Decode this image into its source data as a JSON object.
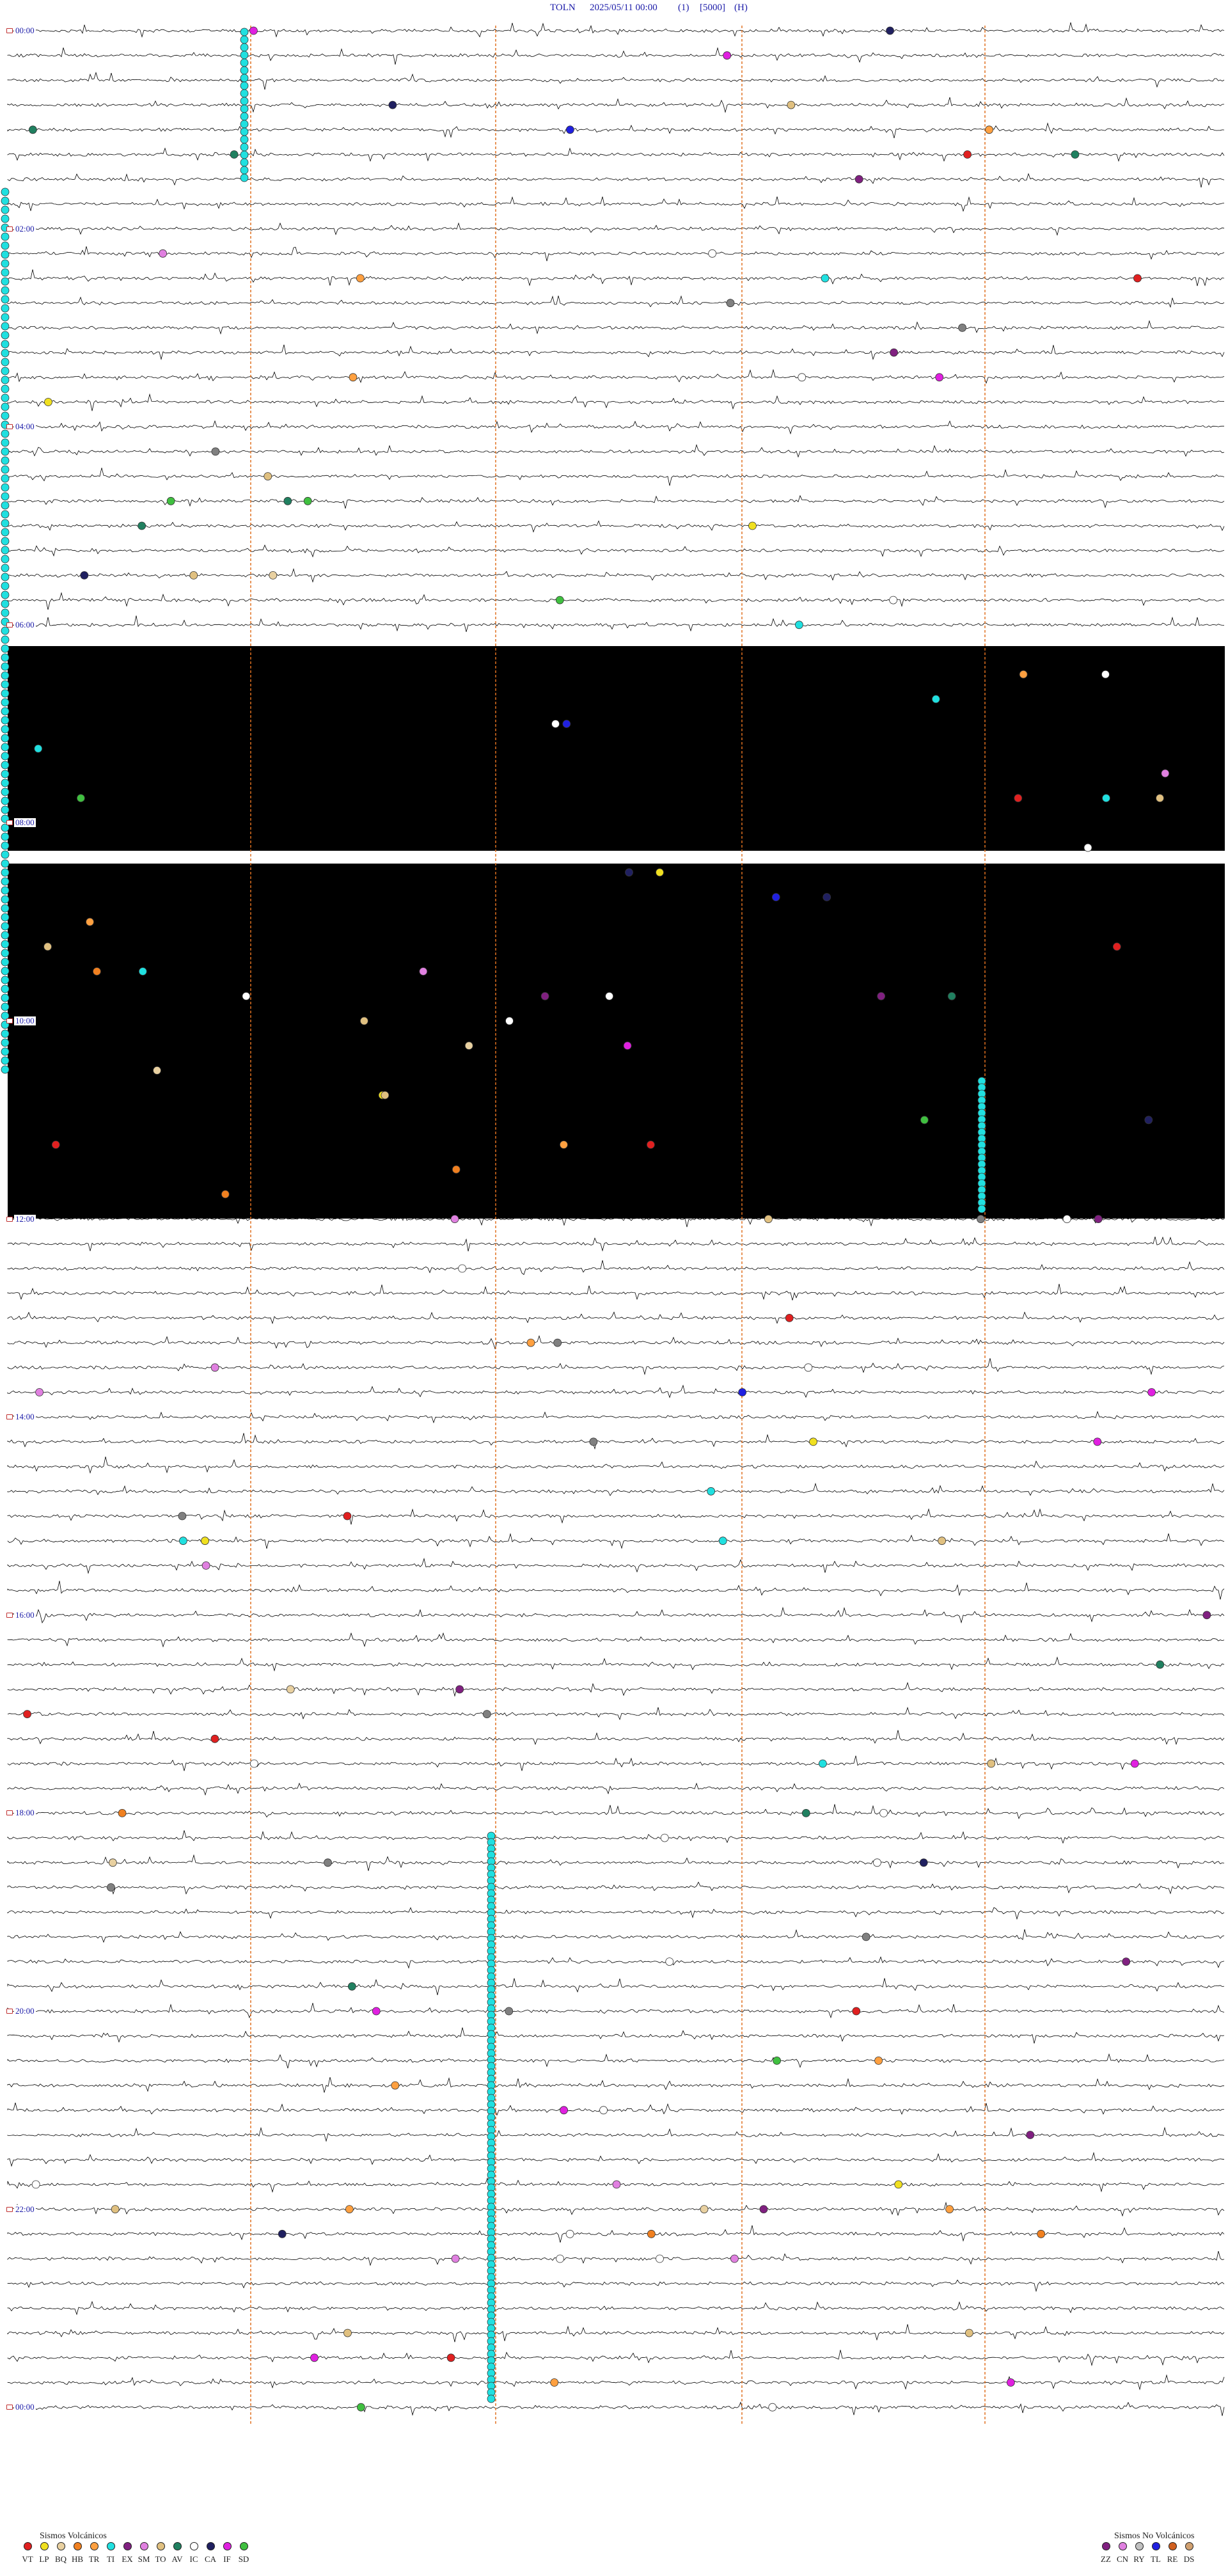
{
  "header": {
    "station": "TOLN",
    "datetime": "2025/05/11 00:00",
    "channel": "(1)",
    "gain": "[5000]",
    "unit": "(H)"
  },
  "time_labels": [
    {
      "text": "00:00",
      "trace": 0
    },
    {
      "text": "02:00",
      "trace": 8
    },
    {
      "text": "04:00",
      "trace": 16
    },
    {
      "text": "06:00",
      "trace": 24
    },
    {
      "text": "08:00",
      "trace": 32
    },
    {
      "text": "10:00",
      "trace": 40
    },
    {
      "text": "12:00",
      "trace": 48
    },
    {
      "text": "14:00",
      "trace": 56
    },
    {
      "text": "16:00",
      "trace": 64
    },
    {
      "text": "18:00",
      "trace": 72
    },
    {
      "text": "20:00",
      "trace": 80
    },
    {
      "text": "22:00",
      "trace": 88
    },
    {
      "text": "00:00",
      "trace": 96
    }
  ],
  "legend": {
    "volcanic_title": "Sismos Volcánicos",
    "non_volcanic_title": "Sismos No Volcánicos",
    "volcanic": [
      {
        "code": "VT",
        "color": "#e02020"
      },
      {
        "code": "LP",
        "color": "#f0e020"
      },
      {
        "code": "BQ",
        "color": "#e8d0a0"
      },
      {
        "code": "HB",
        "color": "#f08020"
      },
      {
        "code": "TR",
        "color": "#ffa040"
      },
      {
        "code": "TI",
        "color": "#20e0e0"
      },
      {
        "code": "EX",
        "color": "#802080"
      },
      {
        "code": "SM",
        "color": "#e080e0"
      },
      {
        "code": "TO",
        "color": "#e0c080"
      },
      {
        "code": "AV",
        "color": "#208060"
      },
      {
        "code": "IC",
        "color": "#ffffff"
      },
      {
        "code": "CA",
        "color": "#202060"
      },
      {
        "code": "IF",
        "color": "#e020e0"
      },
      {
        "code": "SD",
        "color": "#40c040"
      }
    ],
    "non_volcanic": [
      {
        "code": "ZZ",
        "color": "#802080"
      },
      {
        "code": "CN",
        "color": "#e080e0"
      },
      {
        "code": "RY",
        "color": "#c0c0c0"
      },
      {
        "code": "TL",
        "color": "#2020e0"
      },
      {
        "code": "RE",
        "color": "#d06020"
      },
      {
        "code": "DS",
        "color": "#d0a070"
      }
    ]
  },
  "trace_colors": {
    "trace": "#000000",
    "hour_marker": "#e07020",
    "label_text": "#1a1aa8"
  }
}
